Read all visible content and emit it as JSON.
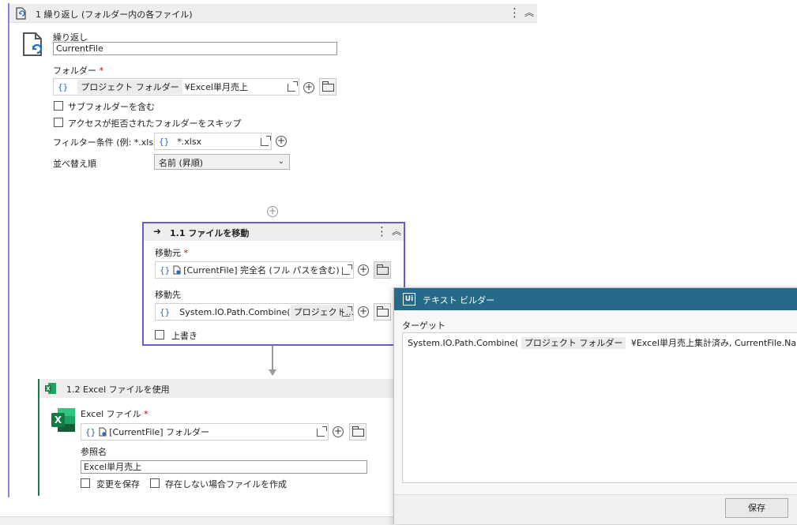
{
  "loop": {
    "header_title": "1 繰り返し (フォルダー内の各ファイル)",
    "kebab": "⋮",
    "collapse": "︽",
    "item_label": "繰り返し",
    "item_value": "CurrentFile",
    "folder_label": "フォルダー",
    "required_mark": "*",
    "brace": "{}",
    "folder_chip": "プロジェクト フォルダー",
    "folder_suffix": "¥Excel単月売上",
    "include_subfolders": "サブフォルダーを含む",
    "skip_denied": "アクセスが拒否されたフォルダーをスキップ",
    "filter_label": "フィルター条件 (例: *.xlsx)",
    "filter_value": "*.xlsx",
    "sort_label": "並べ替え順",
    "sort_value": "名前 (昇順)",
    "plus": "+"
  },
  "move": {
    "header_title": "1.1 ファイルを移動",
    "source_label": "移動元",
    "source_value": "[CurrentFile] 完全名 (フル パスを含む)",
    "dest_label": "移動先",
    "dest_prefix": "System.IO.Path.Combine(",
    "dest_chip": "プロジェクト...",
    "overwrite_label": "上書き"
  },
  "excel": {
    "header_title": "1.2 Excel ファイルを使用",
    "file_label": "Excel ファイル",
    "file_value": "[CurrentFile] フォルダー",
    "ref_label": "参照名",
    "ref_value": "Excel単月売上",
    "save_changes": "変更を保存",
    "create_if_missing": "存在しない場合ファイルを作成",
    "icon_letter": "X"
  },
  "text_builder": {
    "logo": "Ui",
    "title": "テキスト ビルダー",
    "target_label": "ターゲット",
    "expr_prefix": "System.IO.Path.Combine(",
    "expr_chip": "プロジェクト フォルダー",
    "expr_suffix": "¥Excel単月売上集計済み, CurrentFile.Name)",
    "save_button": "保存"
  },
  "colors": {
    "accent_purple": "#6a5acd",
    "excel_green": "#1e7a4a",
    "titlebar_blue": "#266a8a"
  }
}
